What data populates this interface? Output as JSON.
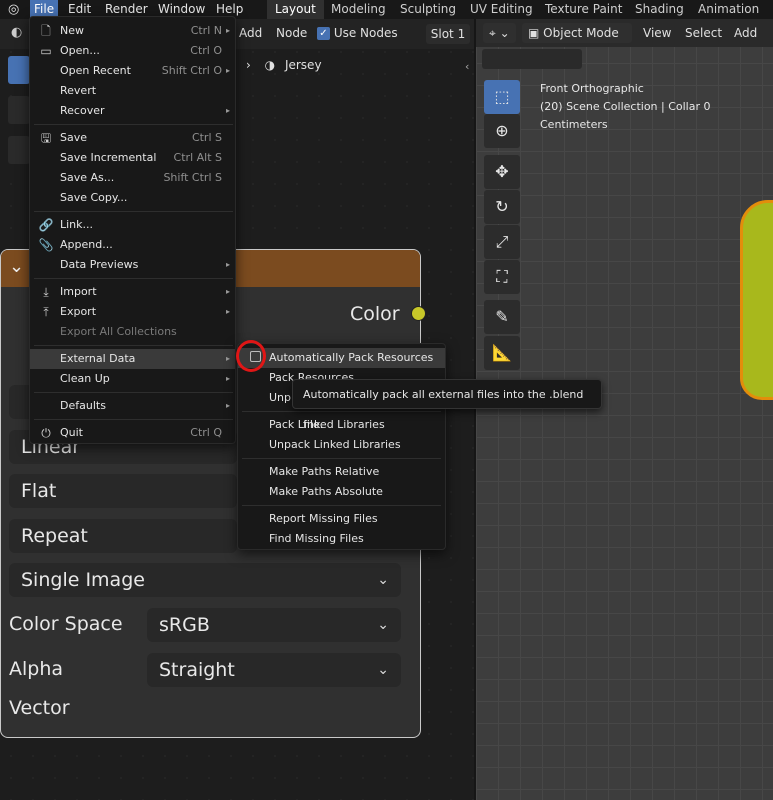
{
  "top_menu": {
    "file": "File",
    "edit": "Edit",
    "render": "Render",
    "window": "Window",
    "help": "Help"
  },
  "workspace_tabs": [
    "Layout",
    "Modeling",
    "Sculpting",
    "UV Editing",
    "Texture Paint",
    "Shading",
    "Animation"
  ],
  "node_editor": {
    "add": "Add",
    "node": "Node",
    "use_nodes": "Use Nodes",
    "slot": "Slot 1",
    "breadcrumb": "Jersey"
  },
  "node_panel": {
    "color_output": "Color",
    "interpolation": "Linear",
    "projection": "Flat",
    "extension": "Repeat",
    "source": "Single Image",
    "color_space_label": "Color Space",
    "color_space_value": "sRGB",
    "alpha_label": "Alpha",
    "alpha_value": "Straight",
    "vector_label": "Vector"
  },
  "viewport": {
    "mode": "Object Mode",
    "view": "View",
    "select": "Select",
    "add": "Add",
    "info_line1": "Front Orthographic",
    "info_line2": "(20) Scene Collection | Collar 0",
    "info_line3": "Centimeters"
  },
  "file_menu": {
    "items": [
      {
        "label": "New",
        "shortcut": "Ctrl N",
        "arrow": "▸"
      },
      {
        "label": "Open...",
        "shortcut": "Ctrl O"
      },
      {
        "label": "Open Recent",
        "shortcut": "Shift Ctrl O",
        "arrow": "▸"
      },
      {
        "label": "Revert"
      },
      {
        "label": "Recover",
        "arrow": "▸"
      },
      {
        "label": "Save",
        "shortcut": "Ctrl S"
      },
      {
        "label": "Save Incremental",
        "shortcut": "Ctrl Alt S"
      },
      {
        "label": "Save As...",
        "shortcut": "Shift Ctrl S"
      },
      {
        "label": "Save Copy..."
      },
      {
        "label": "Link..."
      },
      {
        "label": "Append..."
      },
      {
        "label": "Data Previews",
        "arrow": "▸"
      },
      {
        "label": "Import",
        "arrow": "▸"
      },
      {
        "label": "Export",
        "arrow": "▸"
      },
      {
        "label": "Export All Collections"
      },
      {
        "label": "External Data",
        "arrow": "▸"
      },
      {
        "label": "Clean Up",
        "arrow": "▸"
      },
      {
        "label": "Defaults",
        "arrow": "▸"
      },
      {
        "label": "Quit",
        "shortcut": "Ctrl Q"
      }
    ]
  },
  "external_data_menu": {
    "items": [
      "Automatically Pack Resources",
      "Pack Resources",
      "Unpack Resources",
      "Pack Linked Libraries",
      "Unpack Linked Libraries",
      "Make Paths Relative",
      "Make Paths Absolute",
      "Report Missing Files",
      "Find Missing Files"
    ],
    "visible_partial": {
      "pack_resources": "Pack Resources",
      "unpack": "Unp"
    }
  },
  "tooltip": "Automatically pack all external files into the .blend file.",
  "colors": {
    "accent": "#4772b3",
    "node_header": "#7b4b1f",
    "socket_yellow": "#c7c729",
    "highlight_circle": "#e01616"
  }
}
